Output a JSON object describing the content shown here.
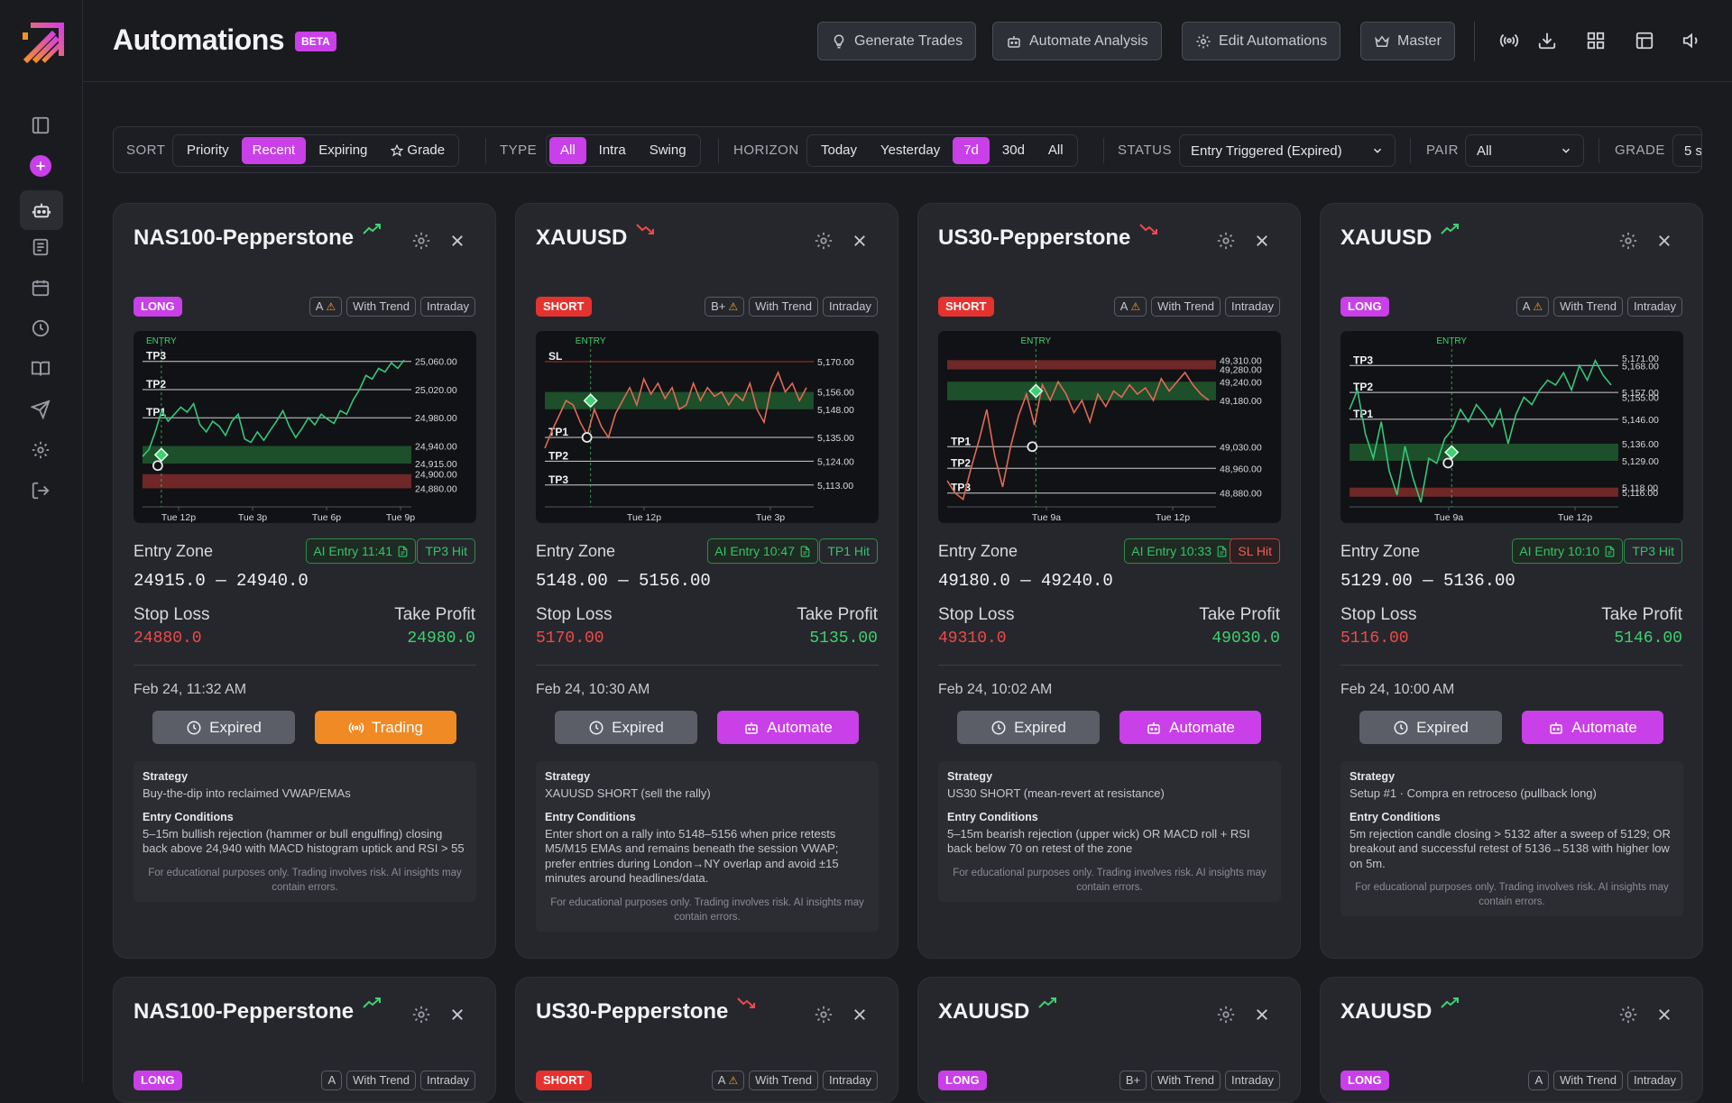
{
  "header": {
    "title": "Automations",
    "badge": "BETA",
    "buttons": [
      {
        "label": "Generate Trades",
        "icon": "lightbulb-icon"
      },
      {
        "label": "Automate Analysis",
        "icon": "robot-icon"
      },
      {
        "label": "Edit Automations",
        "icon": "gear-icon"
      },
      {
        "label": "Master",
        "icon": "crown-icon"
      }
    ],
    "icons": [
      "broadcast-icon",
      "download-icon",
      "grid-icon",
      "layout-icon",
      "volume-icon"
    ]
  },
  "sidebar": {
    "icons": [
      "panel-toggle-icon",
      "add-icon",
      "robot-icon",
      "news-icon",
      "calendar-icon",
      "clock-icon",
      "book-icon",
      "send-icon",
      "settings-icon",
      "logout-icon"
    ],
    "active": "robot-icon"
  },
  "filters": {
    "sort": {
      "label": "SORT",
      "options": [
        "Priority",
        "Recent",
        "Expiring",
        "Grade"
      ],
      "selected": "Recent"
    },
    "type": {
      "label": "TYPE",
      "options": [
        "All",
        "Intra",
        "Swing"
      ],
      "selected": "All"
    },
    "horizon": {
      "label": "HORIZON",
      "options": [
        "Today",
        "Yesterday",
        "7d",
        "30d",
        "All"
      ],
      "selected": "7d"
    },
    "status": {
      "label": "STATUS",
      "value": "Entry Triggered (Expired)"
    },
    "pair": {
      "label": "PAIR",
      "value": "All"
    },
    "grade": {
      "label": "GRADE",
      "value": "5 s"
    }
  },
  "colors": {
    "accent": "#c93fe8",
    "green": "#3dd270",
    "red": "#ee4a4a",
    "orange": "#f08a24"
  },
  "cards": [
    {
      "title": "NAS100-Pepperstone",
      "trend": "up",
      "direction": "LONG",
      "grade": "A",
      "grade_warn": true,
      "tags": [
        "With Trend",
        "Intraday"
      ],
      "ai_entry": "AI Entry 11:41",
      "result": "TP3 Hit",
      "result_type": "tp",
      "entry_zone_label": "Entry Zone",
      "entry_zone": "24915.0 — 24940.0",
      "stop_loss_label": "Stop Loss",
      "stop_loss": "24880.0",
      "take_profit_label": "Take Profit",
      "take_profit": "24980.0",
      "date": "Feb 24, 11:32 AM",
      "expired_label": "Expired",
      "action_label": "Trading",
      "action_style": "orange",
      "strategy_label": "Strategy",
      "strategy": "Buy-the-dip into reclaimed VWAP/EMAs",
      "conditions_label": "Entry Conditions",
      "conditions": "5–15m bullish rejection (hammer or bull engulfing) closing back above 24,940 with MACD histogram uptick and RSI > 55",
      "disclaimer": "For educational purposes only. Trading involves risk. AI insights may contain errors.",
      "chart": {
        "entry_label": "ENTRY",
        "ymin": 24860,
        "ymax": 25075,
        "ticks": [
          "25,060.00",
          "25,020.00",
          "24,980.00",
          "24,940.00",
          "24,915.00",
          "24,900.00",
          "24,880.00"
        ],
        "tick_values": [
          25060,
          25020,
          24980,
          24940,
          24915,
          24900,
          24880
        ],
        "x_labels": [
          "Tue 12p",
          "Tue 3p",
          "Tue 6p",
          "Tue 9p"
        ],
        "levels": [
          {
            "label": "TP3",
            "value": 25060
          },
          {
            "label": "TP2",
            "value": 25020
          },
          {
            "label": "TP1",
            "value": 24980
          }
        ],
        "entry_zone": [
          24915,
          24940
        ],
        "sl_zone": [
          24880,
          24900
        ],
        "entry_x": 0.07,
        "price": [
          24925,
          24935,
          24960,
          24990,
          24975,
          24985,
          24995,
          24988,
          25000,
          24970,
          24960,
          24975,
          24968,
          24955,
          24975,
          24985,
          24950,
          24945,
          24960,
          24948,
          24962,
          24975,
          24990,
          24968,
          24952,
          24965,
          24980,
          24970,
          24985,
          24978,
          24972,
          24990,
          24985,
          25005,
          25020,
          25040,
          25035,
          25050,
          25045,
          25058,
          25050,
          25062
        ]
      }
    },
    {
      "title": "XAUUSD",
      "trend": "down",
      "direction": "SHORT",
      "grade": "B+",
      "grade_warn": true,
      "tags": [
        "With Trend",
        "Intraday"
      ],
      "ai_entry": "AI Entry 10:47",
      "result": "TP1 Hit",
      "result_type": "tp",
      "entry_zone_label": "Entry Zone",
      "entry_zone": "5148.00 — 5156.00",
      "stop_loss_label": "Stop Loss",
      "stop_loss": "5170.00",
      "take_profit_label": "Take Profit",
      "take_profit": "5135.00",
      "date": "Feb 24, 10:30 AM",
      "expired_label": "Expired",
      "action_label": "Automate",
      "action_style": "purple",
      "strategy_label": "Strategy",
      "strategy": "XAUUSD SHORT (sell the rally)",
      "conditions_label": "Entry Conditions",
      "conditions": "Enter short on a rally into 5148–5156 when price retests M5/M15 EMAs and remains beneath the session VWAP; prefer entries during London→NY overlap and avoid ±15 minutes around headlines/data.",
      "disclaimer": "For educational purposes only. Trading involves risk. AI insights may contain errors.",
      "chart": {
        "entry_label": "ENTRY",
        "ymin": 5105,
        "ymax": 5175,
        "ticks": [
          "5,170.00",
          "5,156.00",
          "5,148.00",
          "5,135.00",
          "5,124.00",
          "5,113.00"
        ],
        "tick_values": [
          5170,
          5156,
          5148,
          5135,
          5124,
          5113
        ],
        "x_labels": [
          "Tue 12p",
          "Tue 3p"
        ],
        "levels": [
          {
            "label": "SL",
            "value": 5170
          },
          {
            "label": "TP1",
            "value": 5135
          },
          {
            "label": "TP2",
            "value": 5124
          },
          {
            "label": "TP3",
            "value": 5113
          }
        ],
        "entry_zone": [
          5148,
          5156
        ],
        "sl_zone": null,
        "entry_x": 0.17,
        "price": [
          5130,
          5138,
          5145,
          5152,
          5150,
          5142,
          5136,
          5148,
          5140,
          5135,
          5146,
          5152,
          5158,
          5150,
          5162,
          5155,
          5160,
          5153,
          5158,
          5148,
          5150,
          5160,
          5152,
          5158,
          5154,
          5156,
          5150,
          5155,
          5152,
          5160,
          5148,
          5142,
          5158,
          5165,
          5156,
          5160,
          5152,
          5158
        ]
      }
    },
    {
      "title": "US30-Pepperstone",
      "trend": "down",
      "direction": "SHORT",
      "grade": "A",
      "grade_warn": true,
      "tags": [
        "With Trend",
        "Intraday"
      ],
      "ai_entry": "AI Entry 10:33",
      "result": "SL Hit",
      "result_type": "sl",
      "entry_zone_label": "Entry Zone",
      "entry_zone": "49180.0 — 49240.0",
      "stop_loss_label": "Stop Loss",
      "stop_loss": "49310.0",
      "take_profit_label": "Take Profit",
      "take_profit": "49030.0",
      "date": "Feb 24, 10:02 AM",
      "expired_label": "Expired",
      "action_label": "Automate",
      "action_style": "purple",
      "strategy_label": "Strategy",
      "strategy": "US30 SHORT (mean-revert at resistance)",
      "conditions_label": "Entry Conditions",
      "conditions": "5–15m bearish rejection (upper wick) OR MACD roll + RSI back below 70 on retest of the zone",
      "disclaimer": "For educational purposes only. Trading involves risk. AI insights may contain errors.",
      "chart": {
        "entry_label": "ENTRY",
        "ymin": 48850,
        "ymax": 49340,
        "ticks": [
          "49,310.00",
          "49,280.00",
          "49,240.00",
          "49,180.00",
          "49,030.00",
          "48,960.00",
          "48,880.00"
        ],
        "tick_values": [
          49310,
          49280,
          49240,
          49180,
          49030,
          48960,
          48880
        ],
        "x_labels": [
          "Tue 9a",
          "Tue 12p"
        ],
        "levels": [
          {
            "label": "TP1",
            "value": 49030
          },
          {
            "label": "TP2",
            "value": 48960
          },
          {
            "label": "TP3",
            "value": 48880
          }
        ],
        "entry_zone": [
          49180,
          49240
        ],
        "sl_zone": [
          49280,
          49310
        ],
        "entry_x": 0.33,
        "price": [
          48920,
          48880,
          48860,
          48960,
          49050,
          49150,
          49000,
          48900,
          49030,
          49130,
          49200,
          49100,
          49230,
          49180,
          49240,
          49200,
          49140,
          49180,
          49110,
          49200,
          49160,
          49210,
          49190,
          49230,
          49200,
          49220,
          49180,
          49250,
          49210,
          49240,
          49270,
          49230,
          49200,
          49180
        ]
      }
    },
    {
      "title": "XAUUSD",
      "trend": "up",
      "direction": "LONG",
      "grade": "A",
      "grade_warn": true,
      "tags": [
        "With Trend",
        "Intraday"
      ],
      "ai_entry": "AI Entry 10:10",
      "result": "TP3 Hit",
      "result_type": "tp",
      "entry_zone_label": "Entry Zone",
      "entry_zone": "5129.00 — 5136.00",
      "stop_loss_label": "Stop Loss",
      "stop_loss": "5116.00",
      "take_profit_label": "Take Profit",
      "take_profit": "5146.00",
      "date": "Feb 24, 10:00 AM",
      "expired_label": "Expired",
      "action_label": "Automate",
      "action_style": "purple",
      "strategy_label": "Strategy",
      "strategy": "Setup #1 · Compra en retroceso (pullback long)",
      "conditions_label": "Entry Conditions",
      "conditions": "5m rejection candle closing > 5132 after a sweep of 5129; OR breakout and successful retest of 5136→5138 with higher low on 5m.",
      "disclaimer": "For educational purposes only. Trading involves risk. AI insights may contain errors.",
      "chart": {
        "entry_label": "ENTRY",
        "ymin": 5112,
        "ymax": 5174,
        "ticks": [
          "5,171.00",
          "5,168.00",
          "5,157.00",
          "5,155.00",
          "5,146.00",
          "5,136.00",
          "5,129.00",
          "5,118.00",
          "5,116.00"
        ],
        "tick_values": [
          5171,
          5168,
          5157,
          5155,
          5146,
          5136,
          5129,
          5118,
          5116
        ],
        "x_labels": [
          "Tue 9a",
          "Tue 12p"
        ],
        "levels": [
          {
            "label": "TP3",
            "value": 5168
          },
          {
            "label": "TP2",
            "value": 5157
          },
          {
            "label": "TP1",
            "value": 5146
          }
        ],
        "entry_zone": [
          5129,
          5136
        ],
        "sl_zone": [
          5116,
          5118
        ],
        "entry_x": 0.38,
        "price": [
          5150,
          5158,
          5140,
          5130,
          5145,
          5125,
          5115,
          5135,
          5122,
          5112,
          5130,
          5128,
          5138,
          5142,
          5150,
          5145,
          5152,
          5148,
          5143,
          5150,
          5136,
          5148,
          5155,
          5152,
          5158,
          5162,
          5160,
          5165,
          5158,
          5168,
          5162,
          5170,
          5164,
          5160
        ]
      }
    },
    {
      "title": "NAS100-Pepperstone",
      "trend": "up",
      "direction": "LONG",
      "grade": "A",
      "grade_warn": false,
      "tags": [
        "With Trend",
        "Intraday"
      ]
    },
    {
      "title": "US30-Pepperstone",
      "trend": "down",
      "direction": "SHORT",
      "grade": "A",
      "grade_warn": true,
      "tags": [
        "With Trend",
        "Intraday"
      ]
    },
    {
      "title": "XAUUSD",
      "trend": "up",
      "direction": "LONG",
      "grade": "B+",
      "grade_warn": false,
      "tags": [
        "With Trend",
        "Intraday"
      ]
    },
    {
      "title": "XAUUSD",
      "trend": "up",
      "direction": "LONG",
      "grade": "A",
      "grade_warn": false,
      "tags": [
        "With Trend",
        "Intraday"
      ]
    }
  ]
}
